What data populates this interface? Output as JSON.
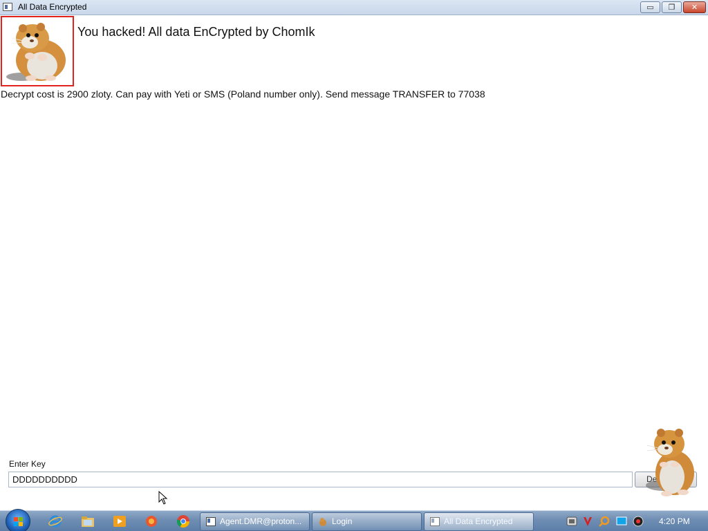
{
  "window": {
    "title": "All Data Encrypted",
    "controls": {
      "minimize": "▭",
      "maximize": "❐",
      "close": "✕"
    }
  },
  "main": {
    "headline": "You hacked! All data EnCrypted by ChomIk",
    "message": "Decrypt cost is 2900 zloty. Can pay with Yeti or SMS (Poland number only). Send message TRANSFER to 77038",
    "key_label": "Enter Key",
    "key_value": "DDDDDDDDDD",
    "decrypt_button_label": "Decrypt"
  },
  "taskbar": {
    "items": [
      {
        "label": "Agent.DMR@proton..."
      },
      {
        "label": "Login"
      },
      {
        "label": "All Data Encrypted"
      }
    ],
    "clock": "4:20 PM"
  },
  "colors": {
    "image_border": "#e0231c",
    "taskbar": "#6e8db3"
  }
}
